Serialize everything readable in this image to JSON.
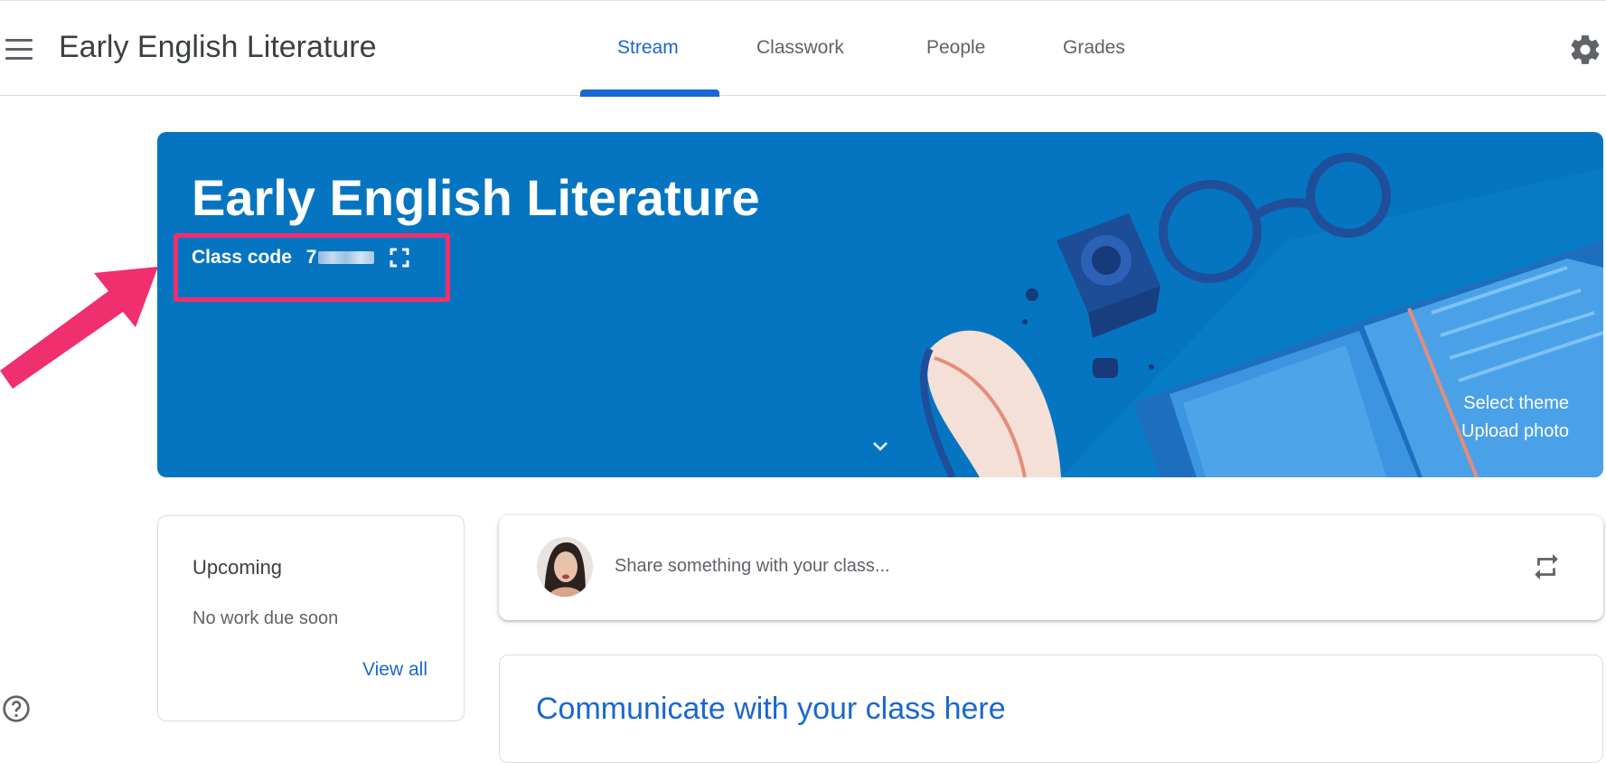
{
  "header": {
    "menu_icon": "hamburger-menu-icon",
    "app_title": "Early English Literature",
    "tabs": [
      {
        "label": "Stream",
        "active": true
      },
      {
        "label": "Classwork",
        "active": false
      },
      {
        "label": "People",
        "active": false
      },
      {
        "label": "Grades",
        "active": false
      }
    ],
    "settings_icon": "gear-icon",
    "accent_color": "#1967d2"
  },
  "banner": {
    "title": "Early English Literature",
    "class_code_label": "Class code",
    "class_code_visible": "7",
    "class_code_obscured": true,
    "expand_icon": "fullscreen-icon",
    "chevron_icon": "chevron-down-icon",
    "select_theme": "Select theme",
    "upload_photo": "Upload photo",
    "background_color": "#0675c1"
  },
  "annotation": {
    "highlight_color": "#ef2f6e"
  },
  "upcoming": {
    "title": "Upcoming",
    "empty_text": "No work due soon",
    "view_all": "View all"
  },
  "share": {
    "placeholder": "Share something with your class...",
    "repost_icon": "repost-icon"
  },
  "communicate": {
    "title": "Communicate with your class here"
  },
  "help_icon": "help-circle-icon"
}
